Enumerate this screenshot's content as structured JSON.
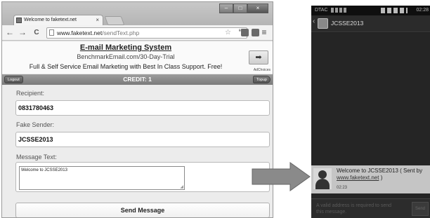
{
  "browser": {
    "tab_title": "Welcome to faketext.net",
    "tab_close": "×",
    "window_controls": {
      "minimize": "–",
      "maximize": "□",
      "close": "×"
    },
    "nav": {
      "back": "←",
      "forward": "→",
      "reload": "C"
    },
    "url_domain": "www.faketext.net",
    "url_path": "/sendText.php",
    "menu_icon": "≡"
  },
  "ad": {
    "title": "E-mail Marketing System",
    "url": "BenchmarkEmail.com/30-Day-Trial",
    "description": "Full & Self Service Email Marketing with Best In Class Support. Free!",
    "arrow": "➡",
    "choices_label": "AdChoices"
  },
  "credit_bar": {
    "logout_label": "Logout",
    "credit_text": "CREDIT: 1",
    "topup_label": "Topup"
  },
  "form": {
    "recipient_label": "Recipient:",
    "recipient_value": "0831780463",
    "sender_label": "Fake Sender:",
    "sender_value": "JCSSE2013",
    "message_label": "Message Text:",
    "message_value": "Welcome to JCSSE2013",
    "send_label": "Send Message"
  },
  "phone": {
    "carrier": "DTAC",
    "time": "02:28",
    "contact_name": "JCSSE2013",
    "message_text": "Welcome to JCSSE2013 ( Sent by",
    "message_link": "www.faketext.net",
    "message_suffix": " )",
    "message_time": "02:23",
    "compose_hint": "A valid address is required to send this message.",
    "send_label": "Send"
  },
  "colors": {
    "credit_bar": "#8a8a8a",
    "phone_bg": "#202020",
    "bubble": "#c5c5c5",
    "arrow": "#888888"
  }
}
